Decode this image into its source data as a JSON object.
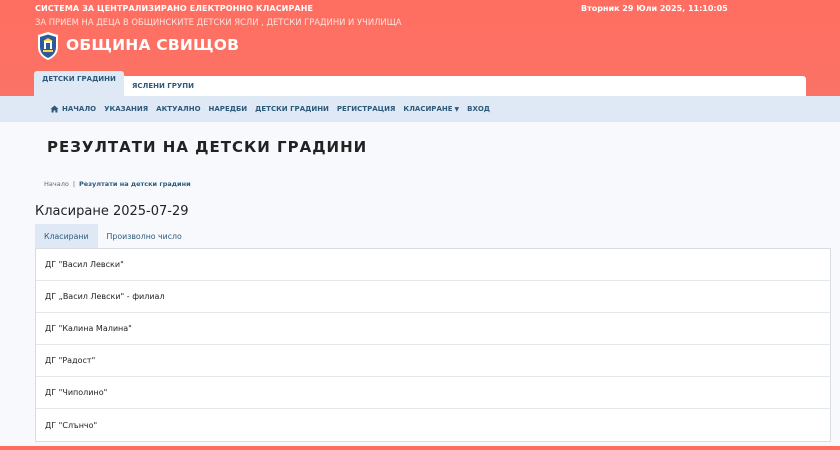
{
  "header": {
    "system_title": "СИСТЕМА ЗА ЦЕНТРАЛИЗИРАНО ЕЛЕКТРОННО КЛАСИРАНЕ",
    "system_subtitle": "ЗА ПРИЕМ НА ДЕЦА В ОБЩИНСКИТЕ ДЕТСКИ ЯСЛИ , ДЕТСКИ ГРАДИНИ И УЧИЛИЩА",
    "datetime": "Вторник 29 Юли 2025, 11:10:05",
    "brand": "ОБЩИНА СВИЩОВ",
    "logo_icon": "municipality-crest-icon",
    "accent_color": "#ff6b5f"
  },
  "top_tabs": [
    {
      "label": "ДЕТСКИ ГРАДИНИ",
      "active": true
    },
    {
      "label": "ЯСЛЕНИ ГРУПИ",
      "active": false
    }
  ],
  "nav": {
    "items": [
      {
        "label": "НАЧАЛО",
        "icon": "home-icon"
      },
      {
        "label": "УКАЗАНИЯ"
      },
      {
        "label": "АКТУАЛНО"
      },
      {
        "label": "НАРЕДБИ"
      },
      {
        "label": "ДЕТСКИ ГРАДИНИ"
      },
      {
        "label": "РЕГИСТРАЦИЯ"
      },
      {
        "label": "КЛАСИРАНЕ",
        "dropdown": true
      },
      {
        "label": "ВХОД"
      }
    ]
  },
  "page": {
    "title": "РЕЗУЛТАТИ НА ДЕТСКИ ГРАДИНИ",
    "breadcrumb": {
      "home": "Начало",
      "separator": "|",
      "current": "Резултати на детски градини"
    },
    "section_title": "Класиране 2025-07-29",
    "subtabs": [
      {
        "label": "Класирани",
        "active": true
      },
      {
        "label": "Произволно число",
        "active": false
      }
    ],
    "kindergartens": [
      "ДГ \"Васил Левски\"",
      "ДГ „Васил Левски\" - филиал",
      "ДГ \"Калина Малина\"",
      "ДГ \"Радост\"",
      "ДГ \"Чиполино\"",
      "ДГ \"Слънчо\""
    ]
  }
}
